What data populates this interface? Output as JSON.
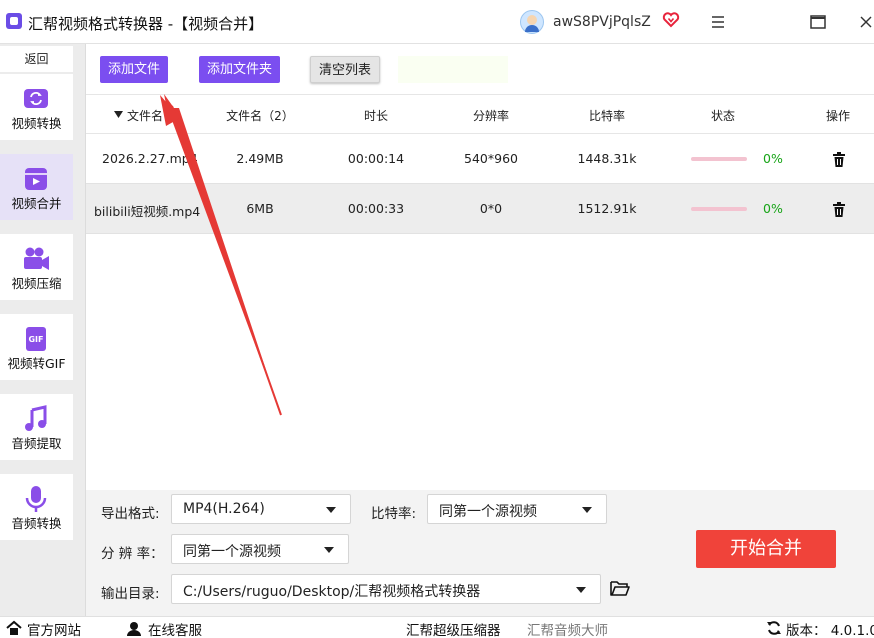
{
  "window": {
    "title": "汇帮视频格式转换器  -【视频合并】",
    "username": "awS8PVjPqlsZ",
    "icons": [
      "app-logo-icon",
      "avatar-icon",
      "vip-heart-icon",
      "menu-icon",
      "maximize-icon",
      "close-icon"
    ]
  },
  "sidebar": {
    "back_label": "返回",
    "items": [
      {
        "label": "视频转换",
        "icon": "video-convert-icon"
      },
      {
        "label": "视频合并",
        "icon": "video-merge-icon",
        "active": true
      },
      {
        "label": "视频压缩",
        "icon": "video-compress-icon"
      },
      {
        "label": "视频转GIF",
        "icon": "gif-icon"
      },
      {
        "label": "音频提取",
        "icon": "music-note-icon"
      },
      {
        "label": "音频转换",
        "icon": "microphone-icon"
      }
    ]
  },
  "toolbar": {
    "add_file": "添加文件",
    "add_folder": "添加文件夹",
    "clear_list": "清空列表"
  },
  "table": {
    "columns": [
      "文件名",
      "文件名（2）",
      "时长",
      "分辨率",
      "比特率",
      "状态",
      "操作"
    ],
    "rows": [
      {
        "name": "2026.2.27.mp4",
        "size": "2.49MB",
        "duration": "00:00:14",
        "resolution": "540*960",
        "bitrate": "1448.31k",
        "status": "0%",
        "progress": 0
      },
      {
        "name": "bilibili短视频.mp4",
        "size": "6MB",
        "duration": "00:00:33",
        "resolution": "0*0",
        "bitrate": "1512.91k",
        "status": "0%",
        "progress": 0
      }
    ]
  },
  "settings": {
    "export_format_label": "导出格式:",
    "export_format_value": "MP4(H.264)",
    "bitrate_label": "比特率:",
    "bitrate_value": "同第一个源视频",
    "resolution_label": "分 辨 率：",
    "resolution_value": "同第一个源视频",
    "output_dir_label": "输出目录:",
    "output_dir_value": "C:/Users/ruguo/Desktop/汇帮视频格式转换器",
    "start_button": "开始合并"
  },
  "footer": {
    "website": "官方网站",
    "support": "在线客服",
    "compressor": "汇帮超级压缩器",
    "audio_master": "汇帮音频大师",
    "version": "版本： 4.0.1.0"
  },
  "colors": {
    "accent": "#7b4ef0",
    "start_button": "#f0433a",
    "progress_text": "#17a417",
    "arrow": "#e53935"
  }
}
